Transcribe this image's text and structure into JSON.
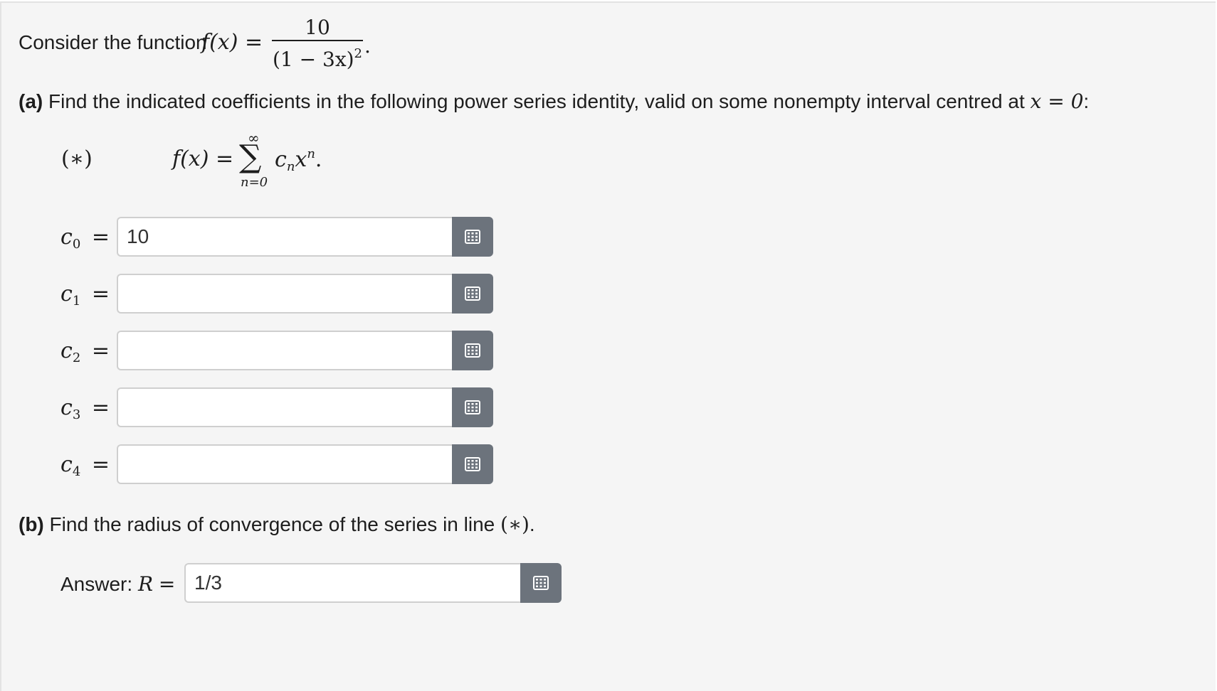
{
  "intro": {
    "prefix": "Consider the function",
    "func": "f(x) =",
    "numerator": "10",
    "denominator_base": "(1 − 3x)",
    "denominator_exp": "2",
    "trailing": "."
  },
  "part_a": {
    "bold": "(a)",
    "text": "Find the indicated coefficients in the following power series identity, valid on some nonempty interval centred at",
    "condition": "x = 0",
    "suffix": ":"
  },
  "series": {
    "marker": "(∗)",
    "lhs": "f(x) =",
    "sigma": "∑",
    "upper": "∞",
    "lower": "n=0",
    "term_c": "c",
    "term_c_sub": "n",
    "term_x": "x",
    "term_x_sup": "n",
    "trailing": "."
  },
  "coefficients": [
    {
      "label": "c",
      "sub": "0",
      "eq": "=",
      "value": "10"
    },
    {
      "label": "c",
      "sub": "1",
      "eq": "=",
      "value": ""
    },
    {
      "label": "c",
      "sub": "2",
      "eq": "=",
      "value": ""
    },
    {
      "label": "c",
      "sub": "3",
      "eq": "=",
      "value": ""
    },
    {
      "label": "c",
      "sub": "4",
      "eq": "=",
      "value": ""
    }
  ],
  "part_b": {
    "bold": "(b)",
    "text": "Find the radius of convergence of the series in line",
    "ref": "(∗)",
    "trailing": "."
  },
  "answer": {
    "prefix": "Answer:",
    "var": "R",
    "eq": "=",
    "value": "1/3"
  },
  "icons": {
    "keypad": "keypad-icon",
    "accent": "#6c737c"
  }
}
